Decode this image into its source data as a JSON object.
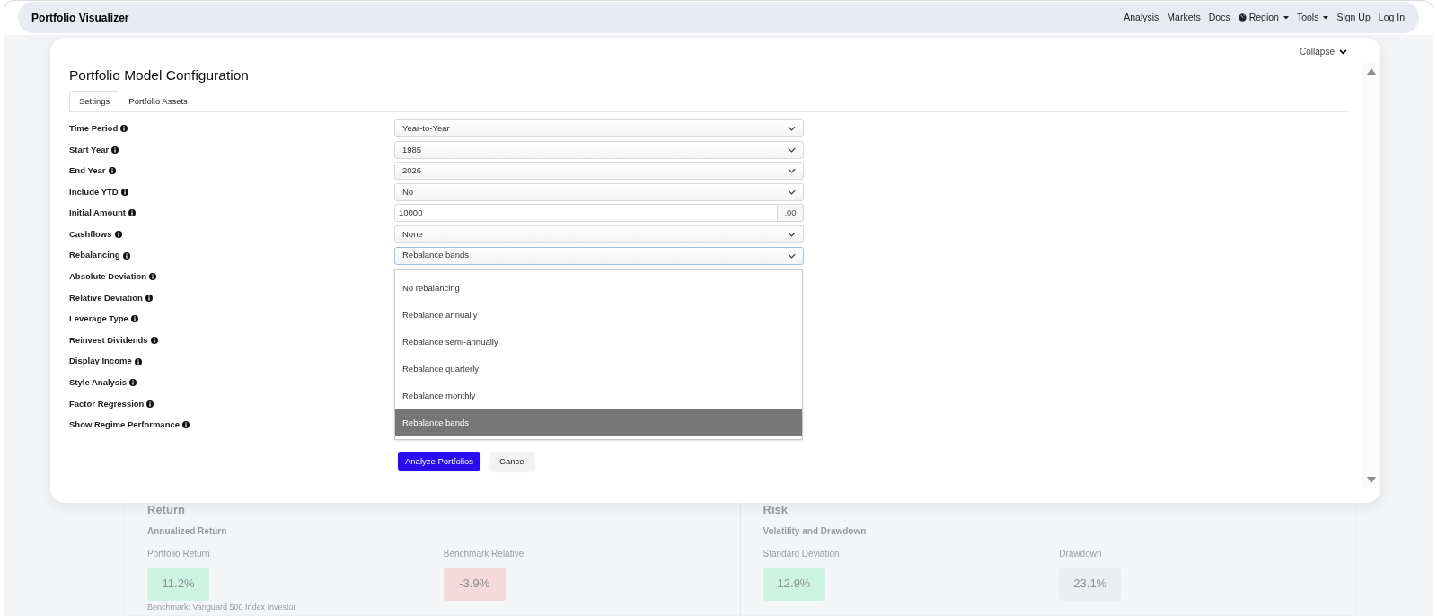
{
  "navbar": {
    "brand": "Portfolio Visualizer",
    "links": [
      {
        "label": "Analysis",
        "kind": "link"
      },
      {
        "label": "Markets",
        "kind": "link"
      },
      {
        "label": "Docs",
        "kind": "link"
      },
      {
        "label": "Region",
        "kind": "locale"
      },
      {
        "label": "Tools",
        "kind": "dropdown"
      },
      {
        "label": "Sign Up",
        "kind": "link"
      },
      {
        "label": "Log In",
        "kind": "link"
      }
    ]
  },
  "modal": {
    "collapse": "Collapse",
    "title": "Portfolio Model Configuration",
    "tabs": [
      {
        "label": "Settings",
        "selected": true
      },
      {
        "label": "Portfolio Assets",
        "selected": false
      }
    ],
    "fields": [
      {
        "label": "Time Period",
        "kind": "select",
        "value": "Year-to-Year"
      },
      {
        "label": "Start Year",
        "kind": "select",
        "value": "1985"
      },
      {
        "label": "End Year",
        "kind": "select",
        "value": "2026"
      },
      {
        "label": "Include YTD",
        "kind": "select",
        "value": "No"
      },
      {
        "label": "Initial Amount",
        "kind": "amount",
        "value": "10000",
        "suffix": ".00"
      },
      {
        "label": "Cashflows",
        "kind": "select",
        "value": "None"
      },
      {
        "label": "Rebalancing",
        "kind": "select",
        "value": "Rebalance bands",
        "expanded": true,
        "options": [
          {
            "label": "No rebalancing",
            "selected": false
          },
          {
            "label": "Rebalance annually",
            "selected": false
          },
          {
            "label": "Rebalance semi-annually",
            "selected": false
          },
          {
            "label": "Rebalance quarterly",
            "selected": false
          },
          {
            "label": "Rebalance monthly",
            "selected": false
          },
          {
            "label": "Rebalance bands",
            "selected": true
          }
        ]
      },
      {
        "label": "Absolute Deviation",
        "kind": "covered"
      },
      {
        "label": "Relative Deviation",
        "kind": "covered"
      },
      {
        "label": "Leverage Type",
        "kind": "covered"
      },
      {
        "label": "Reinvest Dividends",
        "kind": "covered"
      },
      {
        "label": "Display Income",
        "kind": "covered"
      },
      {
        "label": "Style Analysis",
        "kind": "covered"
      },
      {
        "label": "Factor Regression",
        "kind": "covered"
      },
      {
        "label": "Show Regime Performance",
        "kind": "covered"
      }
    ],
    "buttons": [
      {
        "label": "Analyze Portfolios",
        "kind": "primary"
      },
      {
        "label": "Cancel",
        "kind": "secondary"
      }
    ]
  },
  "background": {
    "sections": [
      {
        "title": "Return",
        "subtitle": "Annualized Return",
        "metrics": [
          {
            "label": "Portfolio Return",
            "value": "11.2%",
            "color": "#cdf3e3"
          },
          {
            "label": "Benchmark Relative",
            "value": "-3.9%",
            "color": "#f6d9dc"
          }
        ]
      },
      {
        "title": "Risk",
        "subtitle": "Volatility and Drawdown",
        "metrics": [
          {
            "label": "Standard Deviation",
            "value": "12.9%",
            "color": "#cdf3e3"
          },
          {
            "label": "Drawdown",
            "value": "23.1%",
            "color": "#eceef2"
          }
        ]
      }
    ],
    "note": "Benchmark: Vanguard 500 Index Investor"
  }
}
